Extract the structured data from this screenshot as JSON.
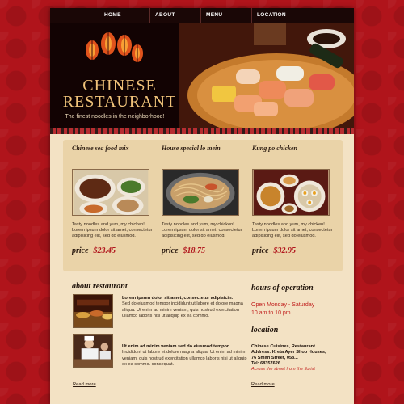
{
  "nav": {
    "items": [
      {
        "label": "HOME"
      },
      {
        "label": "ABOUT"
      },
      {
        "label": "MENU"
      },
      {
        "label": "LOCATION"
      }
    ]
  },
  "header": {
    "title_line1": "CHINESE",
    "title_line2": "RESTAURANT",
    "tagline": "The finest noodles in the neighborhood!"
  },
  "dishes": [
    {
      "title": "Chinese sea food mix",
      "description": "Tasty noodles and yum, my chicken! Lorem ipsum dolor sit amet, consectetur adipisicing elit, sed do eiusmod.",
      "price_label": "price",
      "price": "$23.45"
    },
    {
      "title": "House special lo mein",
      "description": "Tasty noodles and yum, my chicken! Lorem ipsum dolor sit amet, consectetur adipisicing elit, sed do eiusmod.",
      "price_label": "price",
      "price": "$18.75"
    },
    {
      "title": "Kung po chicken",
      "description": "Tasty noodles and yum, my chicken! Lorem ipsum dolor sit amet, consectetur adipisicing elit, sed do eiusmod.",
      "price_label": "price",
      "price": "$32.95"
    }
  ],
  "about": {
    "heading": "about  restaurant",
    "para1_lead": "Lorem ipsum dolor sit amet, consectetur adipisicin.",
    "para1_body": "Sed do eiusmod tempor incididunt ut labore et dolore magna aliqua. Ut enim ad minim veniam, quis nostrud exercitation ullamco laboris nisi ut aliquip ex ea commo.",
    "para2_lead": "Ut enim ad minim veniam sed do eiusmod tempor.",
    "para2_body": "Incididunt ut labore et dolore magna aliqua. Ut enim ad minim veniam, quis nostrud exercitation ullamco laboris nisi ut aliquip ex ea commo. consequat.",
    "read_more": "Read more"
  },
  "hours": {
    "heading": "hours of operation",
    "days": "Open Monday - Saturday",
    "time": "10 am to 10 pm"
  },
  "location": {
    "heading": "location",
    "name": "Chinese Cuisines, Restaurant",
    "address_line1": "Address:  Kreta Ayer Shop Houses,",
    "address_line2": "76 Smith Street, 058...",
    "phone": "Tel:    68357626",
    "note": "Across the street from the florist",
    "read_more": "Read more"
  },
  "colors": {
    "background_red": "#b0141b",
    "page_cream": "#f3e2c4",
    "price_red": "#b1161d",
    "title_gold": "#f1c27a",
    "nav_dark": "#1a0706"
  }
}
